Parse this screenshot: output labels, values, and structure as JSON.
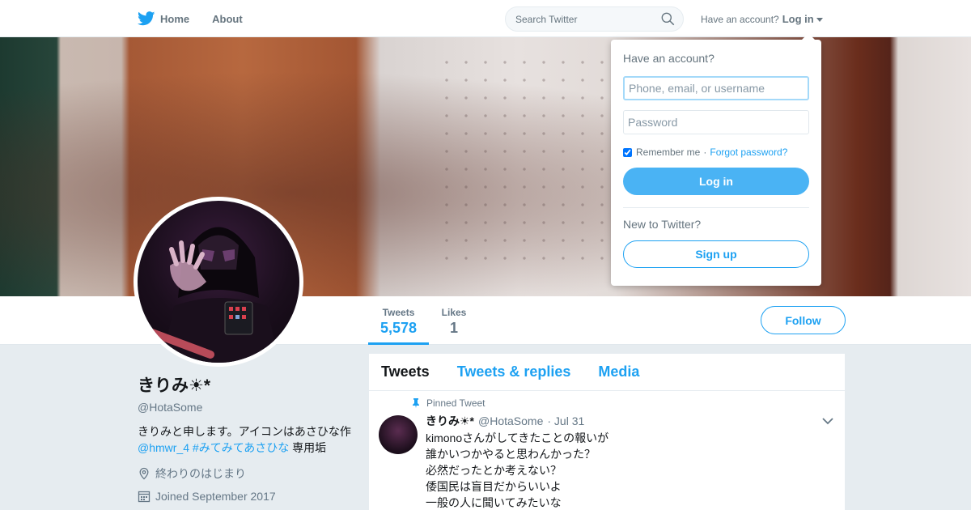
{
  "nav": {
    "home_label": "Home",
    "about_label": "About",
    "search_placeholder": "Search Twitter",
    "account_prompt": "Have an account?",
    "login_label": "Log in"
  },
  "login_dropdown": {
    "title": "Have an account?",
    "username_placeholder": "Phone, email, or username",
    "password_placeholder": "Password",
    "remember_label": "Remember me",
    "separator": "·",
    "forgot_label": "Forgot password?",
    "login_button": "Log in",
    "new_prompt": "New to Twitter?",
    "signup_button": "Sign up"
  },
  "profile_nav": {
    "stats": [
      {
        "label": "Tweets",
        "value": "5,578"
      },
      {
        "label": "Likes",
        "value": "1"
      }
    ],
    "follow_label": "Follow"
  },
  "profile": {
    "name": "きりみ☀*",
    "handle": "@HotaSome",
    "bio_prefix": "きりみと申します。アイコンはあさひな作",
    "bio_mention": "@hmwr_4",
    "bio_hashtag": "#みてみてあさひな",
    "bio_suffix": "専用垢",
    "location": "終わりのはじまり",
    "joined": "Joined September 2017"
  },
  "timeline": {
    "tabs": [
      "Tweets",
      "Tweets & replies",
      "Media"
    ],
    "pinned_label": "Pinned Tweet",
    "tweet": {
      "name": "きりみ☀*",
      "handle": "@HotaSome",
      "date": "· Jul 31",
      "lines": [
        "kimonoさんがしてきたことの報いが",
        "誰かいつかやると思わんかった？",
        "必然だったとか考えない？",
        "倭国民は盲目だからいいよ",
        "一般の人に聞いてみたいな"
      ]
    }
  },
  "colors": {
    "accent": "#1da1f2",
    "login_button_bg": "#4ab3f4",
    "background": "#e6ecf0"
  },
  "icons": [
    "twitter-bird-icon",
    "search-icon",
    "location-icon",
    "calendar-icon",
    "pin-icon",
    "chevron-down-icon"
  ]
}
